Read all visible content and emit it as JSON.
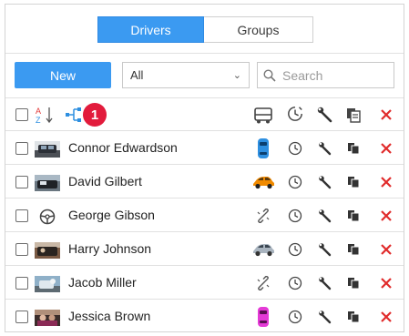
{
  "tabs": [
    {
      "label": "Drivers",
      "active": true
    },
    {
      "label": "Groups",
      "active": false
    }
  ],
  "toolbar": {
    "new_label": "New",
    "filter_value": "All",
    "search_placeholder": "Search"
  },
  "header": {
    "badge_count": "1",
    "icons": [
      "sort-alpha-icon",
      "network-icon",
      "vehicle-header-icon",
      "clock-header-icon",
      "wrench-header-icon",
      "copy-header-icon",
      "delete-header-icon"
    ]
  },
  "drivers": [
    {
      "name": "Connor Edwardson",
      "vehicle_icon": "blue-car-top-icon",
      "vehicle_color": "#2e8fe0"
    },
    {
      "name": "David Gilbert",
      "vehicle_icon": "orange-car-icon",
      "vehicle_color": "#f08a00"
    },
    {
      "name": "George Gibson",
      "vehicle_icon": "unlinked-icon",
      "vehicle_color": "#555555",
      "avatar_icon": "steering-wheel-icon"
    },
    {
      "name": "Harry Johnson",
      "vehicle_icon": "silver-car-icon",
      "vehicle_color": "#9aa6b2"
    },
    {
      "name": "Jacob Miller",
      "vehicle_icon": "unlinked-icon",
      "vehicle_color": "#555555"
    },
    {
      "name": "Jessica Brown",
      "vehicle_icon": "pink-car-top-icon",
      "vehicle_color": "#e43ad6"
    }
  ],
  "colors": {
    "accent": "#3b9af1",
    "delete": "#e02b2b",
    "badge": "#e21b3c"
  }
}
